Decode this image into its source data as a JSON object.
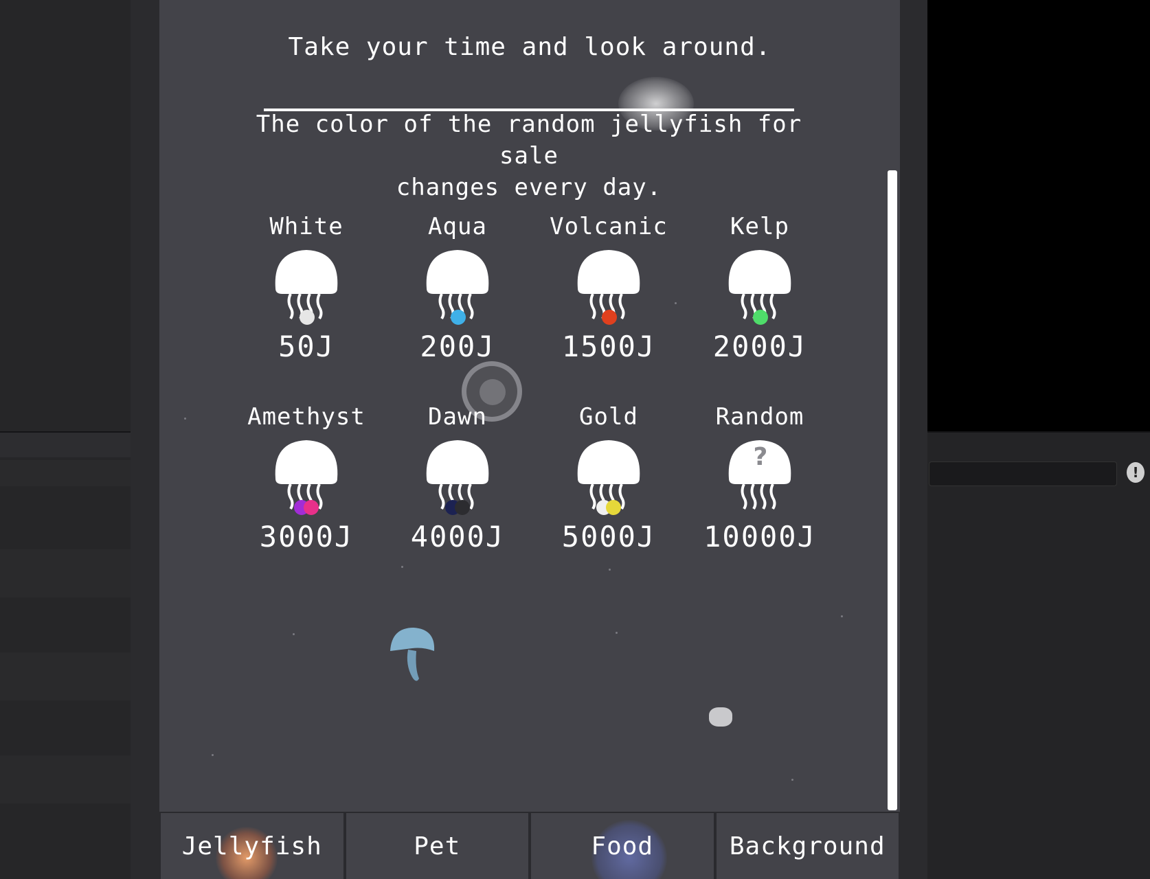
{
  "shop": {
    "header": "Take your time and look around.",
    "description_lines": [
      "The color of the random jellyfish for",
      "sale",
      "changes every day."
    ],
    "items": [
      {
        "name": "White",
        "price": "50J",
        "colors": [
          "#e6e6e6"
        ],
        "icon": "jellyfish-icon"
      },
      {
        "name": "Aqua",
        "price": "200J",
        "colors": [
          "#3fb0e8"
        ],
        "icon": "jellyfish-icon"
      },
      {
        "name": "Volcanic",
        "price": "1500J",
        "colors": [
          "#e0401e"
        ],
        "icon": "jellyfish-icon"
      },
      {
        "name": "Kelp",
        "price": "2000J",
        "colors": [
          "#4fdc6a"
        ],
        "icon": "jellyfish-icon"
      },
      {
        "name": "Amethyst",
        "price": "3000J",
        "colors": [
          "#a22dd6",
          "#e8308a"
        ],
        "icon": "jellyfish-icon"
      },
      {
        "name": "Dawn",
        "price": "4000J",
        "colors": [
          "#1c2252",
          "#2c2c30"
        ],
        "icon": "jellyfish-icon"
      },
      {
        "name": "Gold",
        "price": "5000J",
        "colors": [
          "#f0f0f0",
          "#e6d83a"
        ],
        "icon": "jellyfish-icon"
      },
      {
        "name": "Random",
        "price": "10000J",
        "colors": [],
        "icon": "question-jellyfish-icon",
        "mark": "?"
      }
    ]
  },
  "tabs": [
    {
      "label": "Jellyfish"
    },
    {
      "label": "Pet"
    },
    {
      "label": "Food"
    },
    {
      "label": "Background"
    }
  ],
  "side_icon": "!",
  "colors": {
    "panel": "#434349",
    "text": "#ffffff"
  }
}
